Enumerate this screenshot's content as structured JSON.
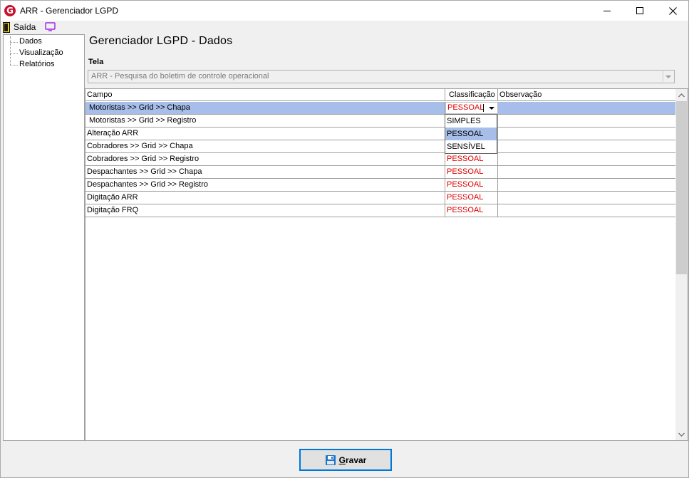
{
  "window": {
    "title": "ARR - Gerenciador LGPD",
    "logo_letter": "G",
    "brand_color": "#c8102e"
  },
  "menu": {
    "exit_label": "Saída",
    "exit_icon": "door-exit-icon",
    "display_icon": "monitor-icon"
  },
  "sidebar": {
    "items": [
      {
        "label": "Dados"
      },
      {
        "label": "Visualização"
      },
      {
        "label": "Relatórios"
      }
    ]
  },
  "main": {
    "title": "Gerenciador LGPD - Dados",
    "tela_label": "Tela",
    "tela_value": "ARR - Pesquisa do boletim de controle operacional"
  },
  "grid": {
    "columns": [
      "Campo",
      "Classificação",
      "Observação"
    ],
    "rows": [
      {
        "campo": "Motoristas >> Grid >> Chapa",
        "classificacao": "PESSOAL",
        "observacao": "",
        "selected": true
      },
      {
        "campo": "Motoristas >> Grid >> Registro",
        "classificacao": "",
        "observacao": ""
      },
      {
        "campo": "Alteração ARR",
        "classificacao": "",
        "observacao": ""
      },
      {
        "campo": "Cobradores >> Grid >> Chapa",
        "classificacao": "",
        "observacao": ""
      },
      {
        "campo": "Cobradores >> Grid >> Registro",
        "classificacao": "PESSOAL",
        "observacao": ""
      },
      {
        "campo": "Despachantes >> Grid >> Chapa",
        "classificacao": "PESSOAL",
        "observacao": ""
      },
      {
        "campo": "Despachantes >> Grid >> Registro",
        "classificacao": "PESSOAL",
        "observacao": ""
      },
      {
        "campo": "Digitação ARR",
        "classificacao": "PESSOAL",
        "observacao": ""
      },
      {
        "campo": "Digitação FRQ",
        "classificacao": "PESSOAL",
        "observacao": ""
      }
    ],
    "dropdown_options": [
      "SIMPLES",
      "PESSOAL",
      "SENSÍVEL"
    ],
    "dropdown_highlighted": "PESSOAL",
    "selection_color": "#a6bee9",
    "classification_color": "#e00000"
  },
  "footer": {
    "save_mnemonic": "G",
    "save_rest": "ravar",
    "save_icon": "floppy-disk-icon"
  }
}
